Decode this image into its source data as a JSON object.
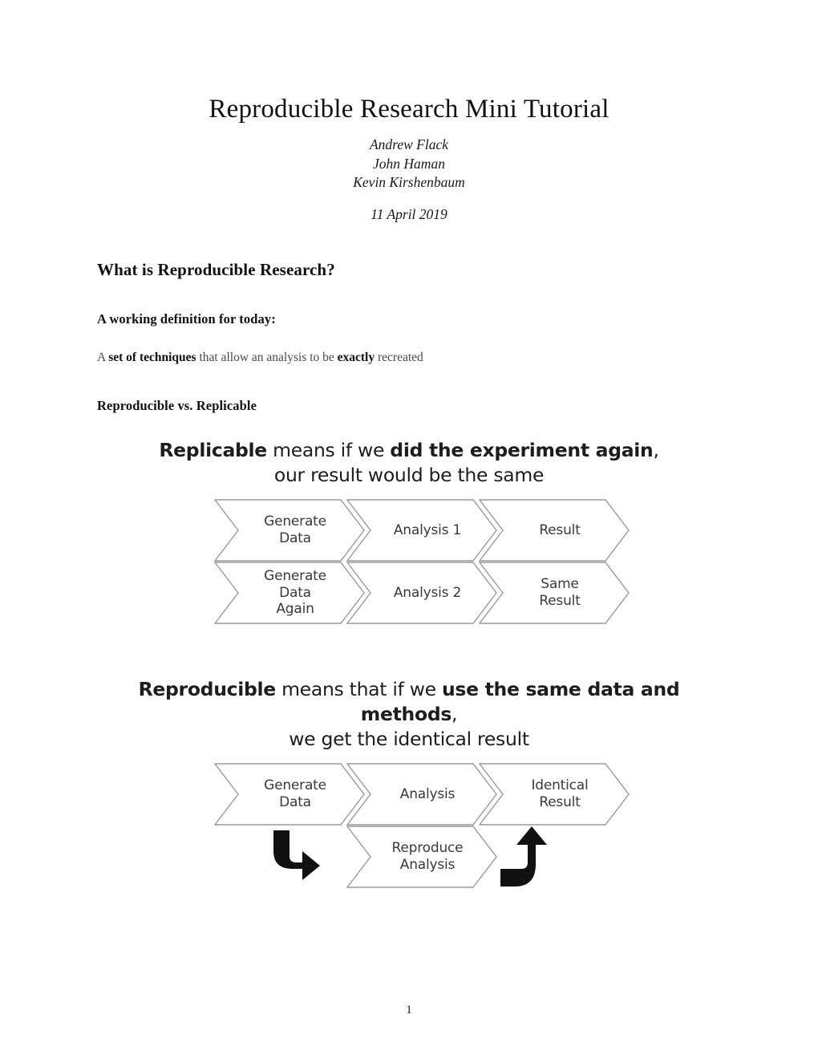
{
  "document": {
    "title": "Reproducible Research Mini Tutorial",
    "authors": [
      "Andrew Flack",
      "John Haman",
      "Kevin Kirshenbaum"
    ],
    "date": "11 April 2019",
    "page_number": "1"
  },
  "sections": {
    "heading": "What is Reproducible Research?",
    "subheading_definition": "A working definition for today:",
    "definition_parts": {
      "pre": "A ",
      "bold1": "set of techniques",
      "mid": " that allow an analysis to be ",
      "bold2": "exactly",
      "post": " recreated"
    },
    "subheading_compare": "Reproducible vs. Replicable"
  },
  "figures": [
    {
      "name": "replicable-figure",
      "caption": {
        "bold1": "Replicable",
        "text1": " means if we ",
        "bold2": "did the experiment again",
        "text2": ",",
        "line2": "our result would be the same"
      },
      "rows": [
        {
          "steps": [
            "Generate\nData",
            "Analysis 1",
            "Result"
          ]
        },
        {
          "steps": [
            "Generate\nData\nAgain",
            "Analysis 2",
            "Same\nResult"
          ]
        }
      ]
    },
    {
      "name": "reproducible-figure",
      "caption": {
        "bold1": "Reproducible",
        "text1": " means that if we ",
        "bold2": "use the same data and methods",
        "text2": ",",
        "line2": "we get the identical result"
      },
      "rows": [
        {
          "steps": [
            "Generate\nData",
            "Analysis",
            "Identical\nResult"
          ]
        }
      ],
      "reproduce_step": "Reproduce\nAnalysis",
      "arrows": [
        "down-right-elbow-arrow",
        "up-elbow-arrow"
      ]
    }
  ],
  "colors": {
    "chevron_stroke": "#9a9a9a",
    "chevron_fill": "#ffffff",
    "chevron_label": "#3a3a3a",
    "caption_text": "#1d1d1d",
    "arrow_fill": "#111111",
    "body_text": "#4a4a4a"
  }
}
